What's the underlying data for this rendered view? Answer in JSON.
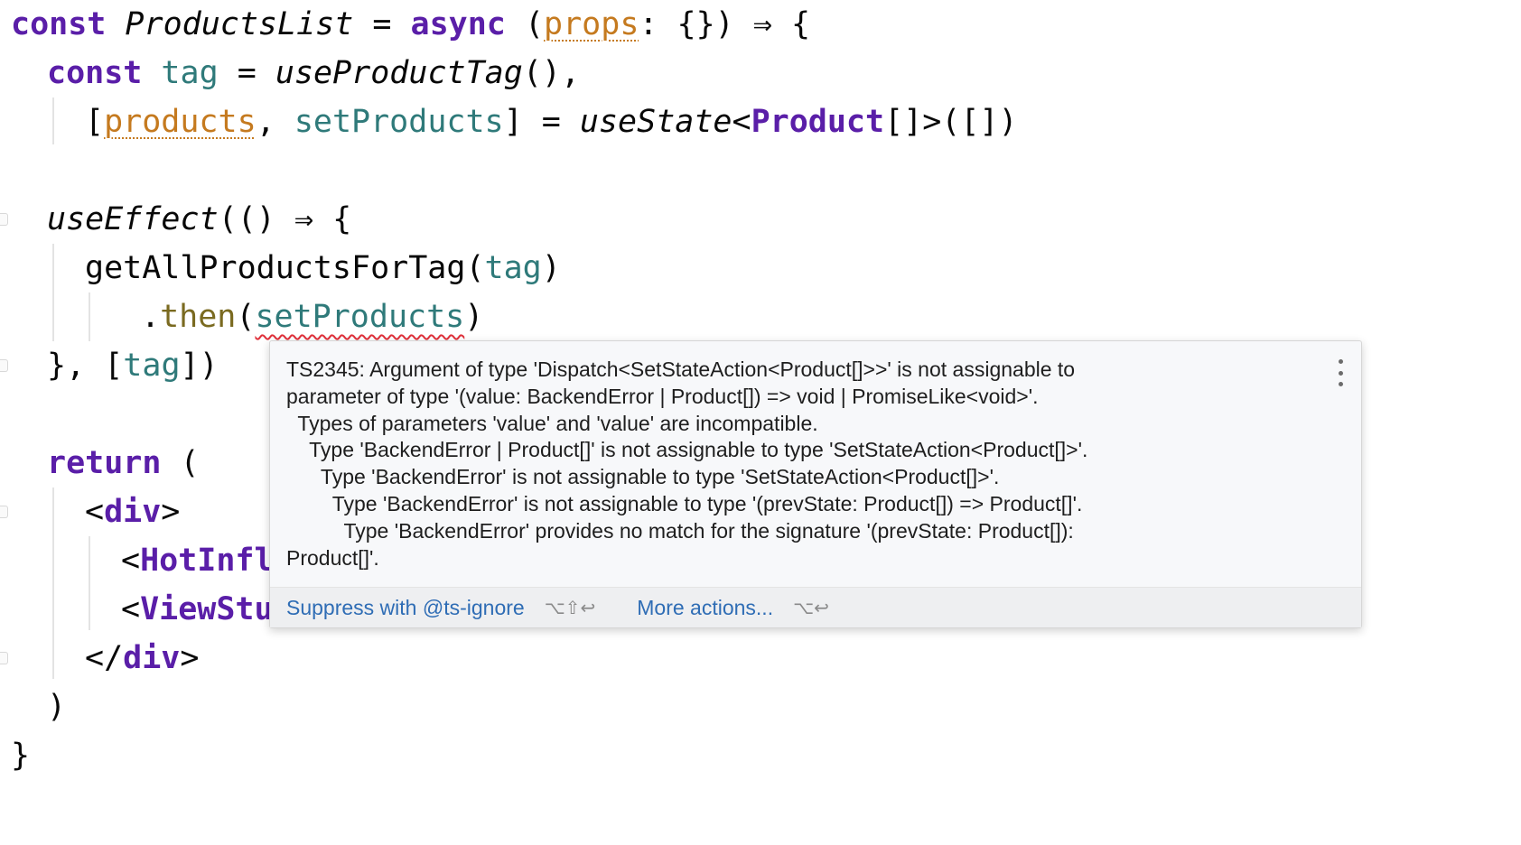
{
  "code": {
    "l1": {
      "kw": "const",
      "name": " ProductsList",
      "eq": " = ",
      "async": "async",
      "open": " (",
      "param": "props",
      "rest": ": {}) ⇒ {"
    },
    "l2": {
      "kw": "const",
      "var": " tag",
      "rest": " = ",
      "fn": "useProductTag",
      "tail": "(),"
    },
    "l3": {
      "open": "[",
      "warn": "products",
      "comma": ", ",
      "var": "setProducts",
      "mid": "] = ",
      "fn": "useState",
      "lt": "<",
      "type": "Product",
      "tail": "[]>([])"
    },
    "l5": {
      "fn": "useEffect",
      "tail": "(() ⇒ {"
    },
    "l6": {
      "fn": "getAllProductsForTag",
      "open": "(",
      "var": "tag",
      "close": ")"
    },
    "l7": {
      "dot": ".",
      "then": "then",
      "open": "(",
      "err": "setProducts",
      "close": ")"
    },
    "l8": {
      "open": "}, [",
      "var": "tag",
      "close": "])"
    },
    "l10": {
      "kw": "return",
      "tail": " ("
    },
    "l11": {
      "lt": "<",
      "tag": "div",
      "gt": ">"
    },
    "l12": {
      "lt": "<",
      "tag": "HotInfl"
    },
    "l13": {
      "lt": "<",
      "tag": "ViewStu"
    },
    "l14": {
      "lt": "</",
      "tag": "div",
      "gt": ">"
    },
    "l15": {
      "text": ")"
    },
    "l16": {
      "text": "}"
    }
  },
  "popup": {
    "lines": [
      "TS2345: Argument of type 'Dispatch<SetStateAction<Product[]>>' is not assignable to",
      "parameter of type '(value: BackendError | Product[]) => void | PromiseLike<void>'.",
      "  Types of parameters 'value' and 'value' are incompatible.",
      "    Type 'BackendError | Product[]' is not assignable to type 'SetStateAction<Product[]>'.",
      "      Type 'BackendError' is not assignable to type 'SetStateAction<Product[]>'.",
      "        Type 'BackendError' is not assignable to type '(prevState: Product[]) => Product[]'.",
      "          Type 'BackendError' provides no match for the signature '(prevState: Product[]):",
      "Product[]'."
    ],
    "more_icon": "vertical-ellipsis-icon",
    "actions": [
      {
        "label": "Suppress with @ts-ignore",
        "shortcut": "⌥⇧↩"
      },
      {
        "label": "More actions...",
        "shortcut": "⌥↩"
      }
    ]
  },
  "colors": {
    "keyword": "#5a1ea8",
    "variable": "#2f7a7a",
    "warning": "#c57a1f",
    "error": "#e0303a",
    "link": "#2f6db5"
  }
}
